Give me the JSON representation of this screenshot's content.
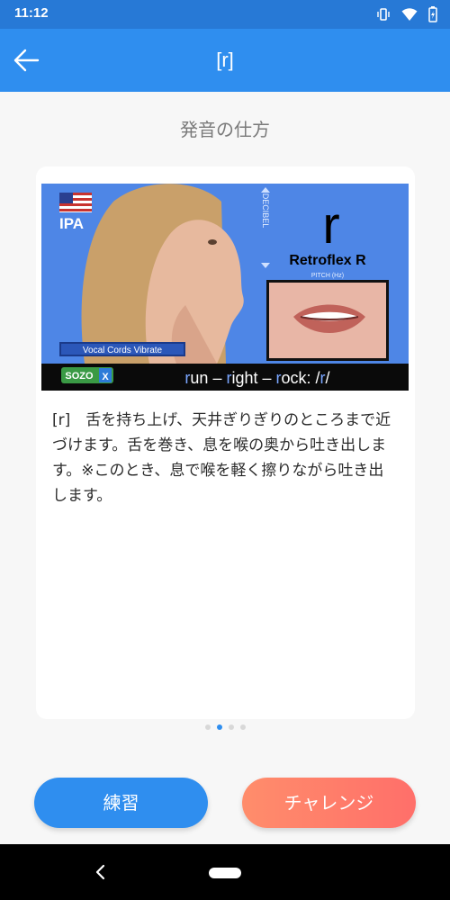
{
  "status_bar": {
    "time": "11:12"
  },
  "app_bar": {
    "title": "[r]"
  },
  "section_title": "発音の仕方",
  "video": {
    "flag_label": "IPA",
    "decibel_label": "DECIBEL",
    "big_letter": "r",
    "sound_name": "Retroflex R",
    "pitch_label": "PITCH (Hz)",
    "vocal_label": "Vocal Cords Vibrate",
    "logo_text": "SOZO",
    "logo_x": "X",
    "example_words": [
      "run",
      "right",
      "rock"
    ],
    "example_separator": " – ",
    "example_ipa": ": /r/"
  },
  "description": "[r]　舌を持ち上げ、天井ぎりぎりのところまで近づけます。舌を巻き、息を喉の奥から吐き出します。※このとき、息で喉を軽く擦りながら吐き出します。",
  "pager": {
    "count": 4,
    "active_index": 1
  },
  "buttons": {
    "practice": "練習",
    "challenge": "チャレンジ"
  },
  "colors": {
    "primary": "#2f8eef",
    "status": "#2779d6",
    "challenge_start": "#ff8d6b",
    "challenge_end": "#ff6f6a"
  }
}
